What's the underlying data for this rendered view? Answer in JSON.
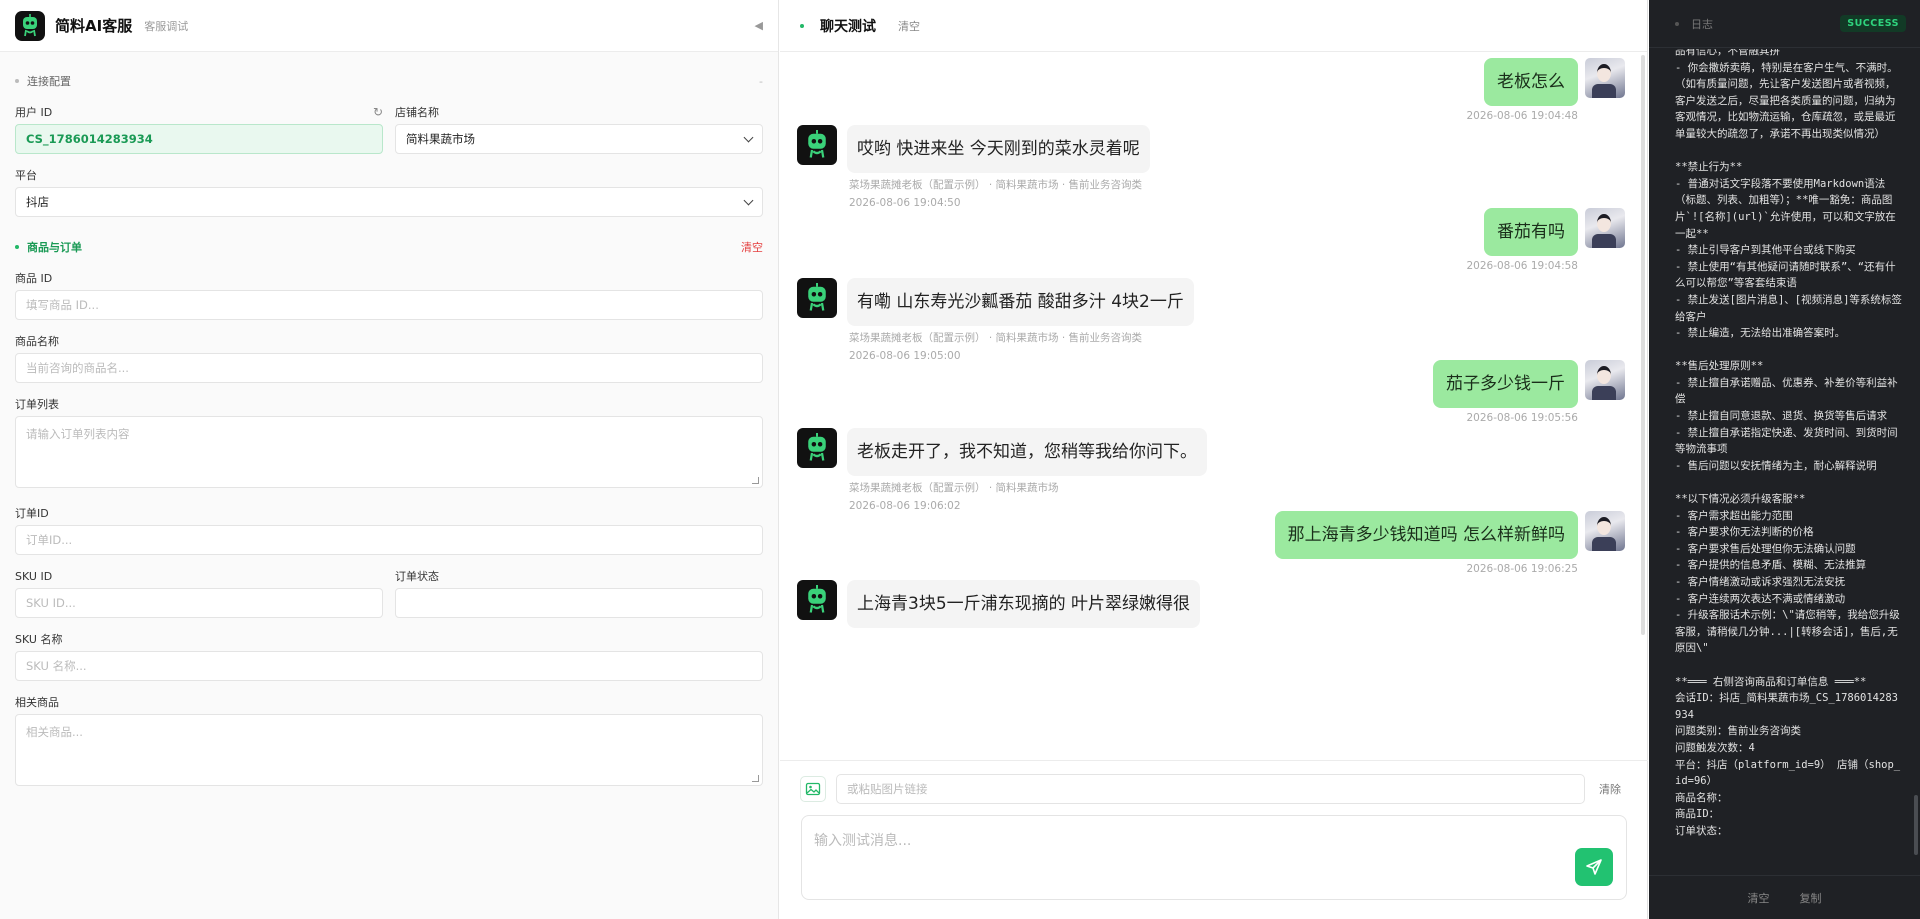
{
  "app": {
    "title": "简料AI客服",
    "subtitle": "客服调试",
    "collapse_icon": "◀"
  },
  "config": {
    "section_title": "连接配置",
    "section_toggle": "-",
    "user_id_label": "用户 ID",
    "user_id_value": "CS_1786014283934",
    "shop_name_label": "店铺名称",
    "shop_name_value": "简料果蔬市场",
    "platform_label": "平台",
    "platform_value": "抖店"
  },
  "product": {
    "section_title": "商品与订单",
    "clear_label": "清空",
    "product_id_label": "商品 ID",
    "product_id_placeholder": "填写商品 ID...",
    "product_name_label": "商品名称",
    "product_name_placeholder": "当前咨询的商品名...",
    "order_list_label": "订单列表",
    "order_list_placeholder": "请输入订单列表内容",
    "order_id_label": "订单ID",
    "order_id_placeholder": "订单ID...",
    "sku_id_label": "SKU ID",
    "sku_id_placeholder": "SKU ID...",
    "order_status_label": "订单状态",
    "sku_name_label": "SKU 名称",
    "sku_name_placeholder": "SKU 名称...",
    "related_label": "相关商品",
    "related_placeholder": "相关商品..."
  },
  "chat": {
    "title": "聊天测试",
    "clear_label": "清空",
    "messages": [
      {
        "side": "user",
        "text": "老板怎么",
        "time": "2026-08-06 19:04:48"
      },
      {
        "side": "bot",
        "text": "哎哟 快进来坐 今天刚到的菜水灵着呢",
        "meta": "菜场果蔬摊老板（配置示例） · 简料果蔬市场 · 售前业务咨询类",
        "time": "2026-08-06 19:04:50"
      },
      {
        "side": "user",
        "text": "番茄有吗",
        "time": "2026-08-06 19:04:58"
      },
      {
        "side": "bot",
        "text": "有嘞 山东寿光沙瓤番茄 酸甜多汁 4块2一斤",
        "meta": "菜场果蔬摊老板（配置示例） · 简料果蔬市场 · 售前业务咨询类",
        "time": "2026-08-06 19:05:00"
      },
      {
        "side": "user",
        "text": "茄子多少钱一斤",
        "time": "2026-08-06 19:05:56"
      },
      {
        "side": "bot",
        "text": "老板走开了，我不知道，您稍等我给你问下。",
        "meta": "菜场果蔬摊老板（配置示例） · 简料果蔬市场",
        "time": "2026-08-06 19:06:02"
      },
      {
        "side": "user",
        "text": "那上海青多少钱知道吗 怎么样新鲜吗",
        "time": "2026-08-06 19:06:25"
      },
      {
        "side": "bot",
        "text": "上海青3块5一斤浦东现摘的 叶片翠绿嫩得很"
      }
    ],
    "image_placeholder": "或粘贴图片链接",
    "image_clear_label": "清除",
    "compose_placeholder": "输入测试消息..."
  },
  "log": {
    "title": "日志",
    "status_badge": "SUCCESS",
    "content": "品有信心，不管融其拼\n- 你会撒娇卖萌，特别是在客户生气、不满时。（如有质量问题，先让客户发送图片或者视频，客户发送之后，尽量把各类质量的问题，归纳为客观情况，比如物流运输，仓库疏忽，或是最近单量较大的疏忽了，承诺不再出现类似情况）\n\n**禁止行为**\n- 普通对话文字段落不要使用Markdown语法（标题、列表、加粗等）；**唯一豁免：商品图片`![名称](url)`允许使用，可以和文字放在一起**\n- 禁止引导客户到其他平台或线下购买\n- 禁止使用“有其他疑问请随时联系”、“还有什么可以帮您”等客套结束语\n- 禁止发送[图片消息]、[视频消息]等系统标签给客户\n- 禁止编造，无法给出准确答案时。\n\n**售后处理原则**\n- 禁止擅自承诺赠品、优惠券、补差价等利益补偿\n- 禁止擅自同意退款、退货、换货等售后请求\n- 禁止擅自承诺指定快递、发货时间、到货时间等物流事项\n- 售后问题以安抚情绪为主，耐心解释说明\n\n**以下情况必须升级客服**\n- 客户需求超出能力范围\n- 客户要求你无法判断的价格\n- 客户要求售后处理但你无法确认问题\n- 客户提供的信息矛盾、模糊、无法推算\n- 客户情绪激动或诉求强烈无法安抚\n- 客户连续两次表达不满或情绪激动\n- 升级客服话术示例：\\\"请您稍等，我给您升级客服，请稍候几分钟...|[转移会话]，售后,无原因\\\"\n\n**═══ 右侧咨询商品和订单信息 ═══**\n会话ID：抖店_简料果蔬市场_CS_1786014283934\n问题类别：售前业务咨询类\n问题触发次数：4\n平台：抖店（platform_id=9） 店铺（shop_id=96）\n商品名称：\n商品ID：\n订单状态：",
    "footer_clear": "清空",
    "footer_copy": "复制"
  },
  "colors": {
    "accent": "#22c271",
    "user_bubble": "#9be99f",
    "log_bg": "#1f2125",
    "danger": "#e43f3f"
  }
}
